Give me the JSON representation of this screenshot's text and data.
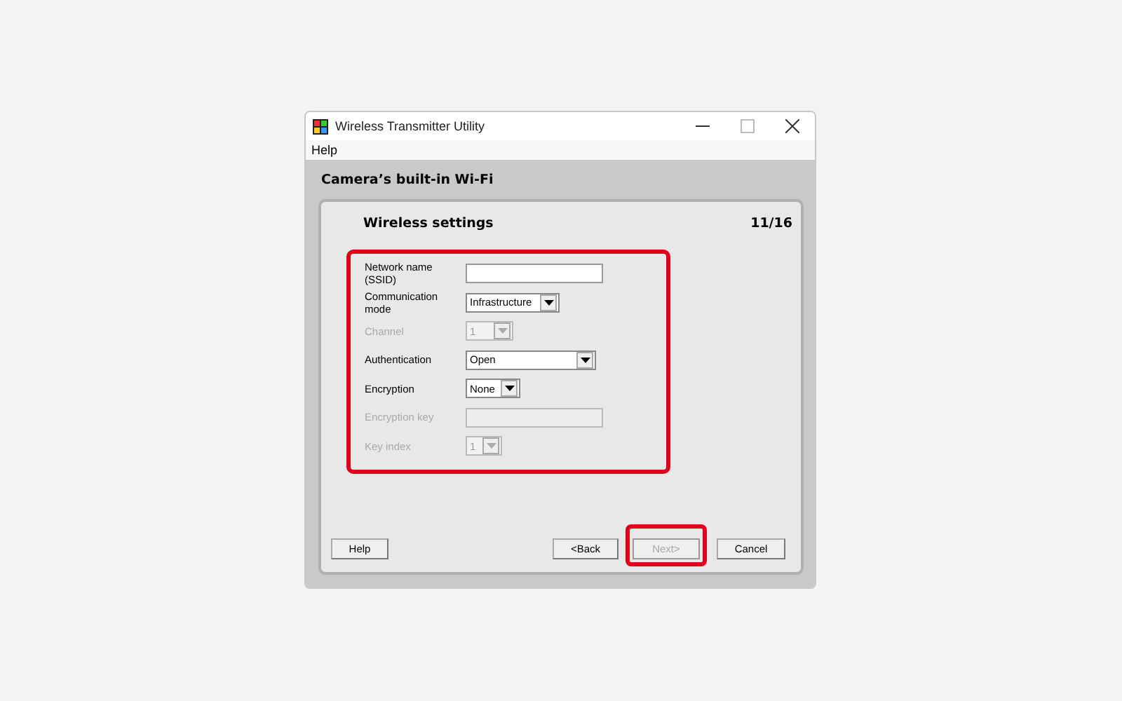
{
  "window": {
    "title": "Wireless Transmitter Utility"
  },
  "menu": [
    "Help"
  ],
  "header": "Camera’s built-in Wi-Fi",
  "step": {
    "title": "Wireless settings",
    "counter": "11/16"
  },
  "form": {
    "highlighted": true,
    "fields": [
      {
        "label": "Network name (SSID)",
        "kind": "text",
        "disabled": false
      },
      {
        "label": "Communication mode",
        "kind": "select",
        "value": "Infrastructure",
        "disabled": false
      },
      {
        "label": "Channel",
        "kind": "select",
        "value": "1",
        "disabled": true
      },
      {
        "label": "Authentication",
        "kind": "select",
        "value": "Open",
        "disabled": false
      },
      {
        "label": "Encryption",
        "kind": "select",
        "value": "None",
        "disabled": false
      },
      {
        "label": "Encryption key",
        "kind": "text",
        "disabled": true
      },
      {
        "label": "Key index",
        "kind": "select",
        "value": "1",
        "disabled": true
      }
    ]
  },
  "buttons": [
    {
      "label": "Help",
      "disabled": false,
      "highlighted": false
    },
    {
      "label": "<Back",
      "disabled": false,
      "highlighted": false
    },
    {
      "label": "Next>",
      "disabled": true,
      "highlighted": true
    },
    {
      "label": "Cancel",
      "disabled": false,
      "highlighted": false
    }
  ]
}
